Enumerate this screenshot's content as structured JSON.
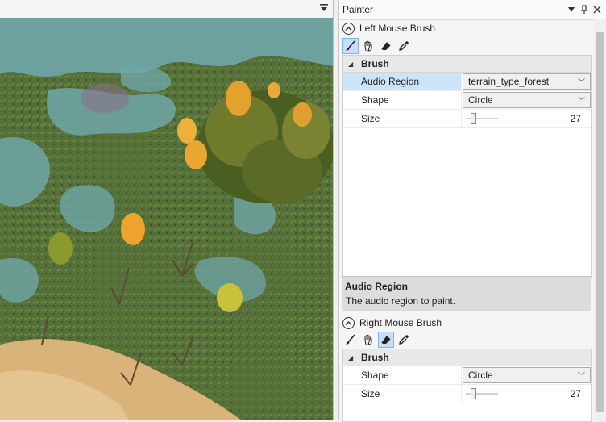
{
  "panel": {
    "title": "Painter",
    "header_icons": [
      "dropdown-arrow-icon",
      "pin-icon",
      "close-icon"
    ]
  },
  "left_brush": {
    "title": "Left Mouse Brush",
    "tools": [
      "paint-brush-icon",
      "hand-icon",
      "eraser-icon",
      "eyedropper-icon"
    ],
    "active_tool": "paint-brush-icon",
    "category": "Brush",
    "properties": {
      "audio_region": {
        "label": "Audio Region",
        "value": "terrain_type_forest"
      },
      "shape": {
        "label": "Shape",
        "value": "Circle"
      },
      "size": {
        "label": "Size",
        "value": "27"
      }
    }
  },
  "description": {
    "title": "Audio Region",
    "text": "The audio region to paint."
  },
  "right_brush": {
    "title": "Right Mouse Brush",
    "tools": [
      "paint-brush-icon",
      "hand-icon",
      "eraser-icon",
      "eyedropper-icon"
    ],
    "active_tool": "eraser-icon",
    "category": "Brush",
    "properties": {
      "shape": {
        "label": "Shape",
        "value": "Circle"
      },
      "size": {
        "label": "Size",
        "value": "27"
      }
    }
  },
  "colors": {
    "selection": "#cce4f7",
    "active_tool": "#c9def5",
    "water": "#6fa6a8",
    "grass": "#56703a",
    "sand": "#d9b37a"
  }
}
